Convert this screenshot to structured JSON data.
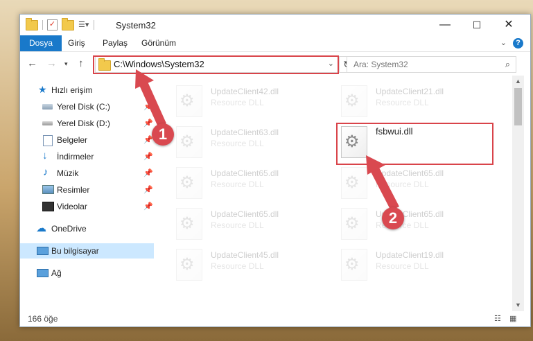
{
  "window": {
    "title": "System32",
    "caption": {
      "minimize": "—",
      "maximize": "☐",
      "close": "✕"
    }
  },
  "ribbon": {
    "tabs": [
      "Dosya",
      "Giriş",
      "Paylaş",
      "Görünüm"
    ],
    "help": "?"
  },
  "nav": {
    "address": "C:\\Windows\\System32",
    "search_placeholder": "Ara: System32"
  },
  "sidebar": {
    "quick_access": "Hızlı erişim",
    "items": [
      {
        "label": "Yerel Disk (C:)",
        "icon": "drive-icon",
        "pinned": true
      },
      {
        "label": "Yerel Disk (D:)",
        "icon": "drive-icon",
        "pinned": true
      },
      {
        "label": "Belgeler",
        "icon": "documents-icon",
        "pinned": true
      },
      {
        "label": "İndirmeler",
        "icon": "download-icon",
        "pinned": true
      },
      {
        "label": "Müzik",
        "icon": "music-icon",
        "pinned": true
      },
      {
        "label": "Resimler",
        "icon": "pictures-icon",
        "pinned": true
      },
      {
        "label": "Videolar",
        "icon": "videos-icon",
        "pinned": true
      }
    ],
    "onedrive": "OneDrive",
    "this_pc": "Bu bilgisayar",
    "network": "Ağ"
  },
  "files": [
    {
      "name": "UpdateClient42.dll",
      "type": "Resource DLL",
      "faded": true
    },
    {
      "name": "UpdateClient21.dll",
      "type": "Resource DLL",
      "faded": true
    },
    {
      "name": "UpdateClient63.dll",
      "type": "Resource DLL",
      "faded": true
    },
    {
      "name": "fsbwui.dll",
      "type": "",
      "faded": false
    },
    {
      "name": "UpdateClient65.dll",
      "type": "Resource DLL",
      "faded": true
    },
    {
      "name": "UpdateClient65.dll",
      "type": "Resource DLL",
      "faded": true
    },
    {
      "name": "UpdateClient65.dll",
      "type": "Resource DLL",
      "faded": true
    },
    {
      "name": "UpdateClient65.dll",
      "type": "Resource DLL",
      "faded": true
    },
    {
      "name": "UpdateClient45.dll",
      "type": "Resource DLL",
      "faded": true
    },
    {
      "name": "UpdateClient19.dll",
      "type": "Resource DLL",
      "faded": true
    }
  ],
  "status": {
    "item_count": "166 öğe"
  },
  "annotations": {
    "badge1": "1",
    "badge2": "2",
    "color": "#d94950"
  }
}
